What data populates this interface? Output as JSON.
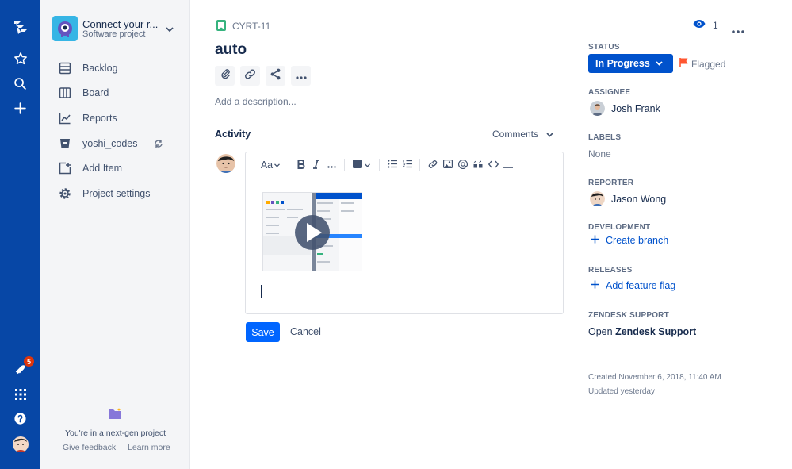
{
  "global_nav": {
    "icons": [
      "jira-logo-icon",
      "star-icon",
      "search-icon",
      "plus-icon",
      "notifications-icon",
      "app-switcher-icon",
      "help-icon",
      "profile-avatar"
    ],
    "notification_count": "5"
  },
  "project": {
    "name": "Connect your r...",
    "type": "Software project"
  },
  "sidebar": {
    "items": [
      {
        "label": "Backlog",
        "icon": "backlog-icon"
      },
      {
        "label": "Board",
        "icon": "board-icon"
      },
      {
        "label": "Reports",
        "icon": "reports-icon"
      },
      {
        "label": "yoshi_codes",
        "icon": "repository-icon"
      },
      {
        "label": "Add Item",
        "icon": "add-item-icon"
      },
      {
        "label": "Project settings",
        "icon": "gear-icon"
      }
    ],
    "nextgen_text": "You're in a next-gen project",
    "give_feedback": "Give feedback",
    "learn_more": "Learn more"
  },
  "issue": {
    "key": "CYRT-11",
    "title": "auto",
    "description_placeholder": "Add a description...",
    "activity_label": "Activity",
    "comments_filter": "Comments",
    "save_label": "Save",
    "cancel_label": "Cancel",
    "editor_text_style": "Aa"
  },
  "details": {
    "watchers": "1",
    "status_label": "STATUS",
    "status_value": "In Progress",
    "flagged": "Flagged",
    "assignee_label": "ASSIGNEE",
    "assignee": "Josh Frank",
    "labels_label": "LABELS",
    "labels_value": "None",
    "reporter_label": "REPORTER",
    "reporter": "Jason Wong",
    "development_label": "DEVELOPMENT",
    "create_branch": "Create branch",
    "releases_label": "RELEASES",
    "add_feature_flag": "Add feature flag",
    "zendesk_label": "ZENDESK SUPPORT",
    "zendesk_prefix": "Open",
    "zendesk_strong": "Zendesk Support",
    "created": "Created November 6, 2018, 11:40 AM",
    "updated": "Updated yesterday"
  },
  "colors": {
    "nav_bg": "#0747a6",
    "primary": "#0052cc",
    "save_btn": "#0065ff",
    "flag": "#ff5630",
    "story": "#36b37e"
  }
}
